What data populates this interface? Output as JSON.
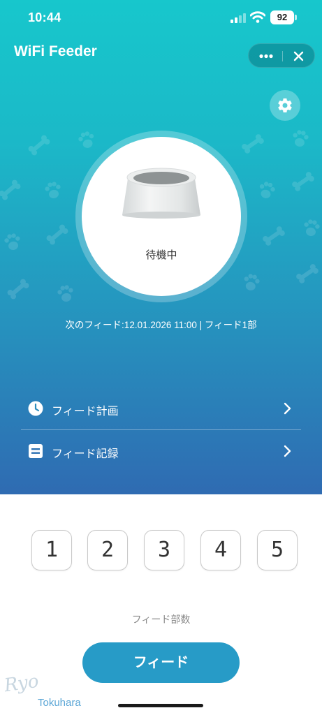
{
  "status_bar": {
    "time": "10:44",
    "battery": "92"
  },
  "app": {
    "title": "WiFi Feeder"
  },
  "capsule": {
    "more_icon": "more-dots-icon",
    "close_icon": "close-icon"
  },
  "settings": {
    "icon": "gear-icon"
  },
  "feeder": {
    "image": "pet-bowl-image",
    "status": "待機中",
    "next_feed": "次のフィード:12.01.2026 11:00 | フィード1部"
  },
  "menu": [
    {
      "label": "フィード計画",
      "icon": "clock-icon"
    },
    {
      "label": "フィード記録",
      "icon": "list-icon"
    }
  ],
  "portions": {
    "options": [
      "1",
      "2",
      "3",
      "4",
      "5"
    ],
    "label": "フィード部数"
  },
  "feed_button": {
    "label": "フィード"
  },
  "watermark": {
    "script": "Ryo",
    "name": "Tokuhara"
  },
  "colors": {
    "gradient_top": "#17c7cc",
    "gradient_bottom": "#2f6bb2",
    "feed_button": "#279bc7"
  }
}
